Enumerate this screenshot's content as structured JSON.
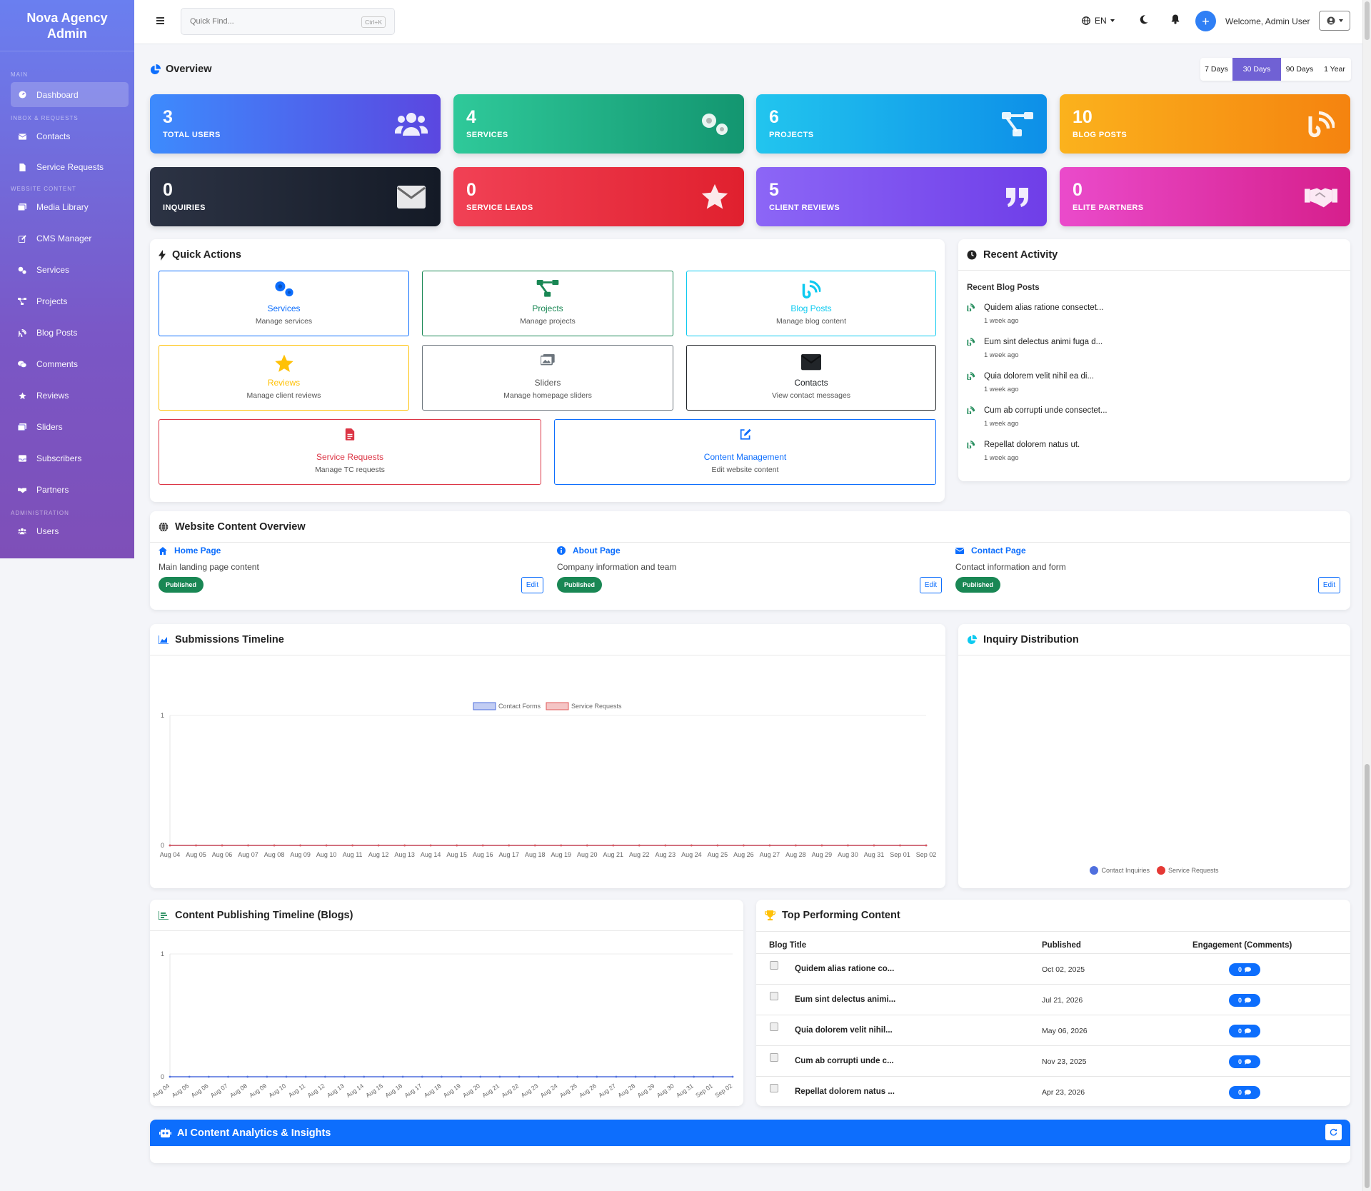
{
  "brand": {
    "line1": "Nova Agency",
    "line2": "Admin"
  },
  "sidebar": {
    "sections": {
      "main": "MAIN",
      "inbox": "INBOX & REQUESTS",
      "content": "WEBSITE CONTENT",
      "admin": "ADMINISTRATION"
    },
    "items": [
      {
        "label": "Dashboard",
        "icon": "dashboard-icon"
      },
      {
        "label": "Contacts",
        "icon": "envelope-icon"
      },
      {
        "label": "Service Requests",
        "icon": "file-icon"
      },
      {
        "label": "Media Library",
        "icon": "photos-icon"
      },
      {
        "label": "CMS Manager",
        "icon": "edit-icon"
      },
      {
        "label": "Services",
        "icon": "gears-icon"
      },
      {
        "label": "Projects",
        "icon": "diagram-icon"
      },
      {
        "label": "Blog Posts",
        "icon": "blog-icon"
      },
      {
        "label": "Comments",
        "icon": "comments-icon"
      },
      {
        "label": "Reviews",
        "icon": "star-icon"
      },
      {
        "label": "Sliders",
        "icon": "images-icon"
      },
      {
        "label": "Subscribers",
        "icon": "inbox-icon"
      },
      {
        "label": "Partners",
        "icon": "handshake-icon"
      },
      {
        "label": "Users",
        "icon": "users-icon"
      }
    ]
  },
  "topbar": {
    "search_placeholder": "Quick Find...",
    "shortcut": "Ctrl+K",
    "language": "EN",
    "welcome": "Welcome, Admin User"
  },
  "overview": {
    "title": "Overview",
    "ranges": [
      "7 Days",
      "30 Days",
      "90 Days",
      "1 Year"
    ],
    "active_range": "30 Days"
  },
  "stats": [
    {
      "value": "3",
      "label": "TOTAL USERS",
      "icon": "users-icon",
      "gradient": [
        "#3d8bfd",
        "#5b47e0"
      ]
    },
    {
      "value": "4",
      "label": "SERVICES",
      "icon": "gears-icon",
      "gradient": [
        "#2fc99a",
        "#139670"
      ]
    },
    {
      "value": "6",
      "label": "PROJECTS",
      "icon": "diagram-icon",
      "gradient": [
        "#22c5ee",
        "#0d8fe8"
      ]
    },
    {
      "value": "10",
      "label": "BLOG POSTS",
      "icon": "blog-icon",
      "gradient": [
        "#fbb21d",
        "#f5830f"
      ]
    },
    {
      "value": "0",
      "label": "INQUIRIES",
      "icon": "envelope-icon",
      "gradient": [
        "#2c3344",
        "#141a26"
      ]
    },
    {
      "value": "0",
      "label": "SERVICE LEADS",
      "icon": "star-icon",
      "gradient": [
        "#f14155",
        "#e0202e"
      ]
    },
    {
      "value": "5",
      "label": "CLIENT REVIEWS",
      "icon": "quote-icon",
      "gradient": [
        "#8c66f6",
        "#6f3ee8"
      ]
    },
    {
      "value": "0",
      "label": "ELITE PARTNERS",
      "icon": "handshake-icon",
      "gradient": [
        "#ea4bcb",
        "#d61f8c"
      ]
    }
  ],
  "quick_actions": {
    "title": "Quick Actions",
    "items": [
      {
        "title": "Services",
        "subtitle": "Manage services",
        "color": "#0d6efd",
        "icon": "gears-icon"
      },
      {
        "title": "Projects",
        "subtitle": "Manage projects",
        "color": "#198754",
        "icon": "diagram-icon"
      },
      {
        "title": "Blog Posts",
        "subtitle": "Manage blog content",
        "color": "#0dcaf0",
        "icon": "blog-icon"
      },
      {
        "title": "Reviews",
        "subtitle": "Manage client reviews",
        "color": "#ffc107",
        "icon": "star-icon"
      },
      {
        "title": "Sliders",
        "subtitle": "Manage homepage sliders",
        "color": "#6c757d",
        "icon": "images-icon"
      },
      {
        "title": "Contacts",
        "subtitle": "View contact messages",
        "color": "#212529",
        "icon": "envelope-icon"
      },
      {
        "title": "Service Requests",
        "subtitle": "Manage TC requests",
        "color": "#dc3545",
        "icon": "file-icon"
      },
      {
        "title": "Content Management",
        "subtitle": "Edit website content",
        "color": "#0d6efd",
        "icon": "edit-icon"
      }
    ]
  },
  "recent_activity": {
    "title": "Recent Activity",
    "subtitle": "Recent Blog Posts",
    "items": [
      {
        "title": "Quidem alias ratione consectet...",
        "time": "1 week ago"
      },
      {
        "title": "Eum sint delectus animi fuga d...",
        "time": "1 week ago"
      },
      {
        "title": "Quia dolorem velit nihil ea di...",
        "time": "1 week ago"
      },
      {
        "title": "Cum ab corrupti unde consectet...",
        "time": "1 week ago"
      },
      {
        "title": "Repellat dolorem natus ut.",
        "time": "1 week ago"
      }
    ]
  },
  "website_content": {
    "title": "Website Content Overview",
    "pages": [
      {
        "title": "Home Page",
        "desc": "Main landing page content",
        "status": "Published",
        "edit": "Edit",
        "icon": "home-icon"
      },
      {
        "title": "About Page",
        "desc": "Company information and team",
        "status": "Published",
        "edit": "Edit",
        "icon": "info-icon"
      },
      {
        "title": "Contact Page",
        "desc": "Contact information and form",
        "status": "Published",
        "edit": "Edit",
        "icon": "envelope-icon"
      }
    ]
  },
  "submissions": {
    "title": "Submissions Timeline"
  },
  "distribution": {
    "title": "Inquiry Distribution",
    "legend": [
      {
        "label": "Contact Inquiries",
        "color": "#4f6fde"
      },
      {
        "label": "Service Requests",
        "color": "#e53935"
      }
    ]
  },
  "publishing": {
    "title": "Content Publishing Timeline (Blogs)"
  },
  "top_content": {
    "title": "Top Performing Content",
    "headers": [
      "Blog Title",
      "Published",
      "Engagement (Comments)"
    ],
    "rows": [
      {
        "title": "Quidem alias ratione co...",
        "date": "Oct 02, 2025",
        "engagement": "0"
      },
      {
        "title": "Eum sint delectus animi...",
        "date": "Jul 21, 2026",
        "engagement": "0"
      },
      {
        "title": "Quia dolorem velit nihil...",
        "date": "May 06, 2026",
        "engagement": "0"
      },
      {
        "title": "Cum ab corrupti unde c...",
        "date": "Nov 23, 2025",
        "engagement": "0"
      },
      {
        "title": "Repellat dolorem natus ...",
        "date": "Apr 23, 2026",
        "engagement": "0"
      }
    ]
  },
  "ai_insights": {
    "title": "AI Content Analytics & Insights"
  },
  "chart_data": [
    {
      "type": "line",
      "x": [
        "Aug 04",
        "Aug 05",
        "Aug 06",
        "Aug 07",
        "Aug 08",
        "Aug 09",
        "Aug 10",
        "Aug 11",
        "Aug 12",
        "Aug 13",
        "Aug 14",
        "Aug 15",
        "Aug 16",
        "Aug 17",
        "Aug 18",
        "Aug 19",
        "Aug 20",
        "Aug 21",
        "Aug 22",
        "Aug 23",
        "Aug 24",
        "Aug 25",
        "Aug 26",
        "Aug 27",
        "Aug 28",
        "Aug 29",
        "Aug 30",
        "Aug 31",
        "Sep 01",
        "Sep 02"
      ],
      "series": [
        {
          "name": "Contact Forms",
          "color": "#4f6fde",
          "values": [
            0,
            0,
            0,
            0,
            0,
            0,
            0,
            0,
            0,
            0,
            0,
            0,
            0,
            0,
            0,
            0,
            0,
            0,
            0,
            0,
            0,
            0,
            0,
            0,
            0,
            0,
            0,
            0,
            0,
            0
          ]
        },
        {
          "name": "Service Requests",
          "color": "#e05a5a",
          "values": [
            0,
            0,
            0,
            0,
            0,
            0,
            0,
            0,
            0,
            0,
            0,
            0,
            0,
            0,
            0,
            0,
            0,
            0,
            0,
            0,
            0,
            0,
            0,
            0,
            0,
            0,
            0,
            0,
            0,
            0
          ]
        }
      ],
      "ylim": [
        0,
        1
      ],
      "yticks": [
        "0",
        "1"
      ],
      "legend": "top"
    },
    {
      "type": "pie",
      "labels": [
        "Contact Inquiries",
        "Service Requests"
      ],
      "values": [
        0,
        0
      ],
      "legend": "bottom"
    },
    {
      "type": "line",
      "x": [
        "Aug 04",
        "Aug 05",
        "Aug 06",
        "Aug 07",
        "Aug 08",
        "Aug 09",
        "Aug 10",
        "Aug 11",
        "Aug 12",
        "Aug 13",
        "Aug 14",
        "Aug 15",
        "Aug 16",
        "Aug 17",
        "Aug 18",
        "Aug 19",
        "Aug 20",
        "Aug 21",
        "Aug 22",
        "Aug 23",
        "Aug 24",
        "Aug 25",
        "Aug 26",
        "Aug 27",
        "Aug 28",
        "Aug 29",
        "Aug 30",
        "Aug 31",
        "Sep 01",
        "Sep 02"
      ],
      "series": [
        {
          "values": [
            0,
            0,
            0,
            0,
            0,
            0,
            0,
            0,
            0,
            0,
            0,
            0,
            0,
            0,
            0,
            0,
            0,
            0,
            0,
            0,
            0,
            0,
            0,
            0,
            0,
            0,
            0,
            0,
            0,
            0
          ]
        }
      ],
      "ylim": [
        0,
        1
      ],
      "yticks": [
        "0",
        "1"
      ]
    }
  ]
}
